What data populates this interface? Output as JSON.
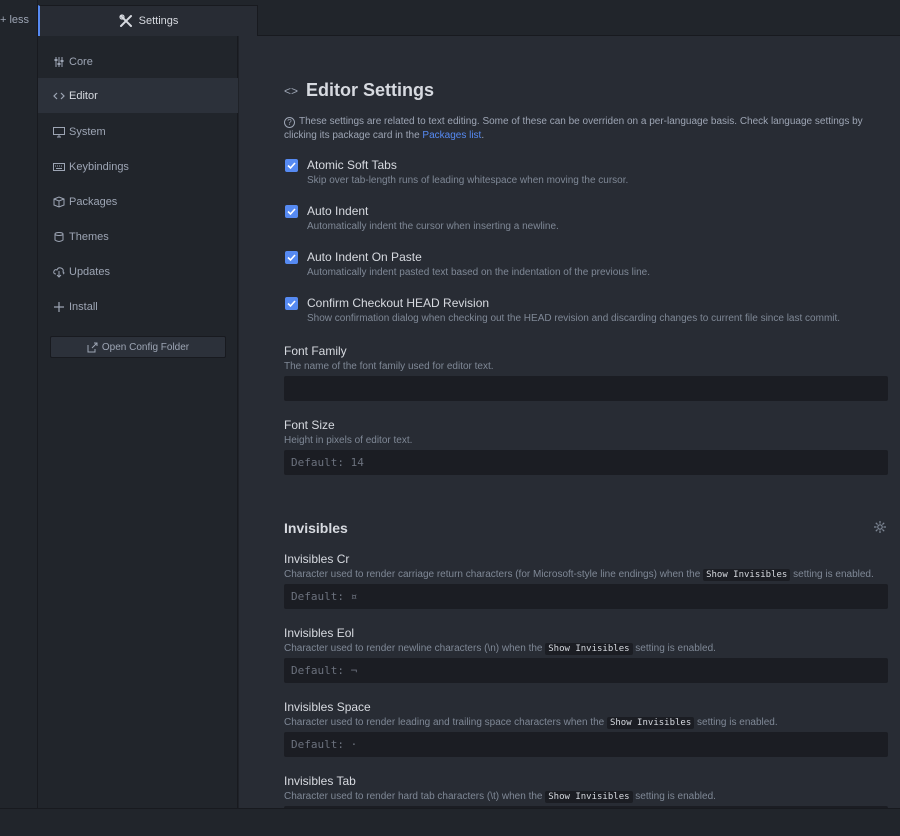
{
  "tree": {
    "item_text": "+ less"
  },
  "tab": {
    "label": "Settings",
    "icon": "tools-icon"
  },
  "nav": {
    "items": [
      {
        "label": "Core",
        "icon": "sliders-icon"
      },
      {
        "label": "Editor",
        "icon": "code-icon",
        "active": true
      },
      {
        "label": "System",
        "icon": "monitor-icon"
      },
      {
        "label": "Keybindings",
        "icon": "keyboard-icon"
      },
      {
        "label": "Packages",
        "icon": "package-icon"
      },
      {
        "label": "Themes",
        "icon": "paintcan-icon"
      },
      {
        "label": "Updates",
        "icon": "cloud-download-icon"
      },
      {
        "label": "Install",
        "icon": "plus-icon"
      }
    ],
    "open_config_label": "Open Config Folder"
  },
  "editor": {
    "title": "Editor Settings",
    "note_text": "These settings are related to text editing. Some of these can be overriden on a per-language basis. Check language settings by clicking its package card in the ",
    "note_link": "Packages list",
    "note_end": ".",
    "checkboxes": [
      {
        "title": "Atomic Soft Tabs",
        "desc": "Skip over tab-length runs of leading whitespace when moving the cursor.",
        "checked": true
      },
      {
        "title": "Auto Indent",
        "desc": "Automatically indent the cursor when inserting a newline.",
        "checked": true
      },
      {
        "title": "Auto Indent On Paste",
        "desc": "Automatically indent pasted text based on the indentation of the previous line.",
        "checked": true
      },
      {
        "title": "Confirm Checkout HEAD Revision",
        "desc": "Show confirmation dialog when checking out the HEAD revision and discarding changes to current file since last commit.",
        "checked": true
      }
    ],
    "font_family": {
      "title": "Font Family",
      "desc": "The name of the font family used for editor text.",
      "value": "",
      "placeholder": ""
    },
    "font_size": {
      "title": "Font Size",
      "desc": "Height in pixels of editor text.",
      "value": "",
      "placeholder": "Default: 14"
    }
  },
  "invisibles": {
    "title": "Invisibles",
    "code_label": "Show Invisibles",
    "fields": [
      {
        "title": "Invisibles Cr",
        "desc_before": "Character used to render carriage return characters (for Microsoft-style line endings) when the ",
        "desc_after": " setting is enabled.",
        "placeholder": "Default: ¤"
      },
      {
        "title": "Invisibles Eol",
        "desc_before": "Character used to render newline characters (\\n) when the ",
        "desc_after": " setting is enabled.",
        "placeholder": "Default: ¬"
      },
      {
        "title": "Invisibles Space",
        "desc_before": "Character used to render leading and trailing space characters when the ",
        "desc_after": " setting is enabled.",
        "placeholder": "Default: ·"
      },
      {
        "title": "Invisibles Tab",
        "desc_before": "Character used to render hard tab characters (\\t) when the ",
        "desc_after": " setting is enabled.",
        "placeholder": ""
      }
    ]
  },
  "colors": {
    "accent": "#568af2",
    "background": "#282c34",
    "panel": "#21252b"
  }
}
